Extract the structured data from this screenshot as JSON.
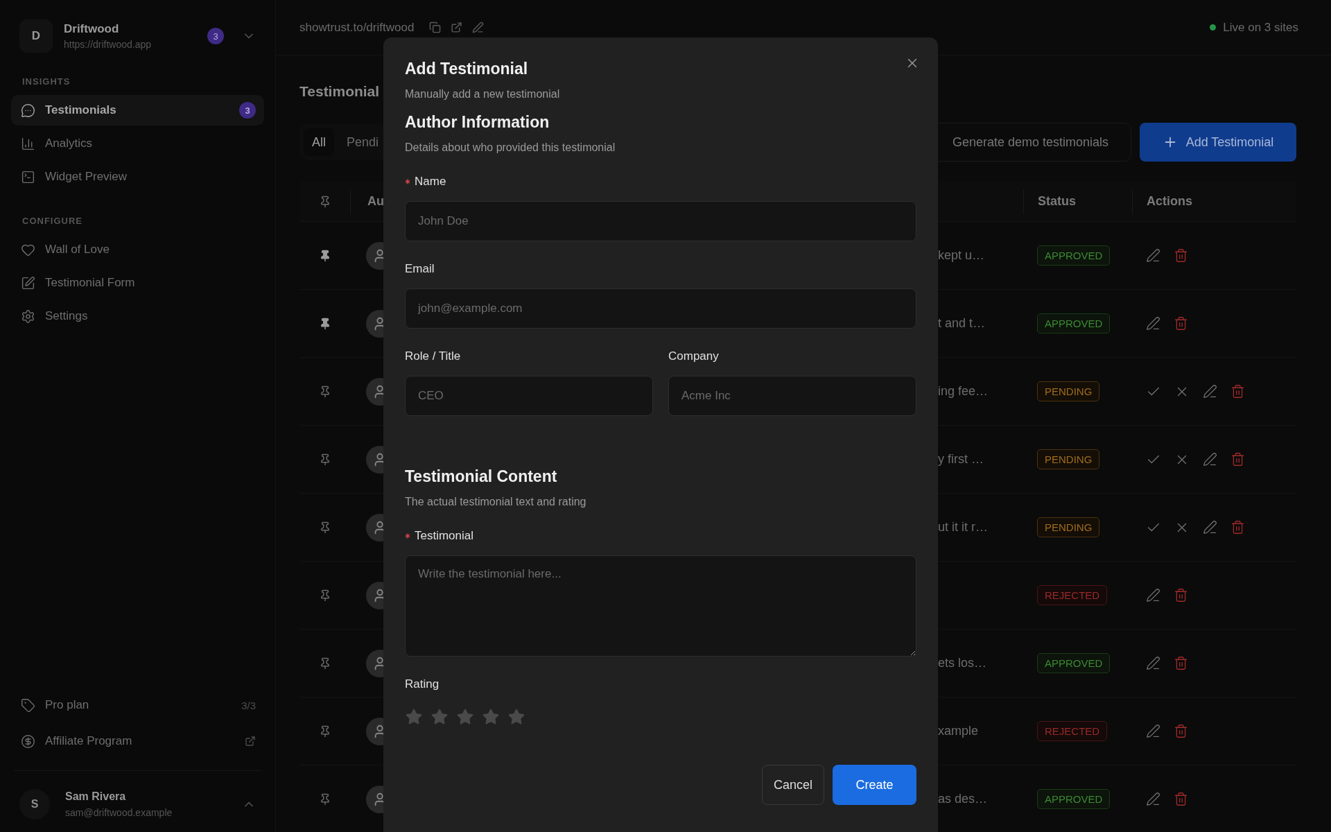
{
  "sidebar": {
    "workspace": {
      "initial": "D",
      "name": "Driftwood",
      "url": "https://driftwood.app",
      "badge": "3"
    },
    "sections": [
      {
        "title": "INSIGHTS",
        "items": [
          {
            "label": "Testimonials",
            "selected": true,
            "badge": "3"
          },
          {
            "label": "Analytics",
            "selected": false
          },
          {
            "label": "Widget Preview",
            "selected": false
          }
        ]
      },
      {
        "title": "CONFIGURE",
        "items": [
          {
            "label": "Wall of Love",
            "selected": false
          },
          {
            "label": "Testimonial Form",
            "selected": false
          },
          {
            "label": "Settings",
            "selected": false
          }
        ]
      }
    ],
    "footer_links": [
      {
        "label": "Pro plan",
        "value": "3/3"
      },
      {
        "label": "Affiliate Program",
        "external": true
      }
    ],
    "user": {
      "initial": "S",
      "name": "Sam Rivera",
      "email": "sam@driftwood.example"
    }
  },
  "top_bar": {
    "url": "showtrust.to/driftwood",
    "live_status": "Live on 3 sites"
  },
  "page": {
    "title": "Testimonial",
    "tabs": [
      {
        "label": "All",
        "selected": true
      },
      {
        "label": "Pendi",
        "selected": false
      }
    ],
    "secondary_button": "Generate demo testimonials",
    "primary_button": "Add Testimonial"
  },
  "table": {
    "columns": [
      "Au",
      "Status",
      "Actions"
    ],
    "rows": [
      {
        "pinned": true,
        "snippet": "kept u…",
        "status": "APPROVED",
        "kind": "approved"
      },
      {
        "pinned": true,
        "snippet": "t and t…",
        "status": "APPROVED",
        "kind": "approved"
      },
      {
        "pinned": false,
        "snippet": "ing fee…",
        "status": "PENDING",
        "kind": "pending"
      },
      {
        "pinned": false,
        "snippet": "y first …",
        "status": "PENDING",
        "kind": "pending"
      },
      {
        "pinned": false,
        "snippet": "ut it it r…",
        "status": "PENDING",
        "kind": "pending"
      },
      {
        "pinned": false,
        "status": "REJECTED",
        "kind": "rejected"
      },
      {
        "pinned": false,
        "snippet": "ets los…",
        "status": "APPROVED",
        "kind": "approved"
      },
      {
        "pinned": false,
        "snippet": "xample",
        "status": "REJECTED",
        "kind": "rejected"
      },
      {
        "pinned": false,
        "snippet": "as des…",
        "status": "APPROVED",
        "kind": "approved"
      }
    ]
  },
  "modal": {
    "title": "Add Testimonial",
    "subtitle": "Manually add a new testimonial",
    "sections": [
      {
        "title": "Author Information",
        "description": "Details about who provided this testimonial",
        "rows": [
          [
            {
              "kind": "text",
              "label": "Name",
              "required": true,
              "placeholder": "John Doe"
            }
          ],
          [
            {
              "kind": "text",
              "label": "Email",
              "required": false,
              "placeholder": "john@example.com"
            }
          ],
          [
            {
              "kind": "text",
              "label": "Role / Title",
              "required": false,
              "placeholder": "CEO"
            },
            {
              "kind": "text",
              "label": "Company",
              "required": false,
              "placeholder": "Acme Inc"
            }
          ]
        ]
      },
      {
        "title": "Testimonial Content",
        "description": "The actual testimonial text and rating",
        "rows": [
          [
            {
              "kind": "textarea",
              "label": "Testimonial",
              "required": true,
              "placeholder": "Write the testimonial here..."
            }
          ],
          [
            {
              "kind": "rating",
              "label": "Rating",
              "required": false,
              "stars": 0
            }
          ]
        ]
      }
    ],
    "buttons": {
      "cancel": "Cancel",
      "create": "Create"
    }
  }
}
